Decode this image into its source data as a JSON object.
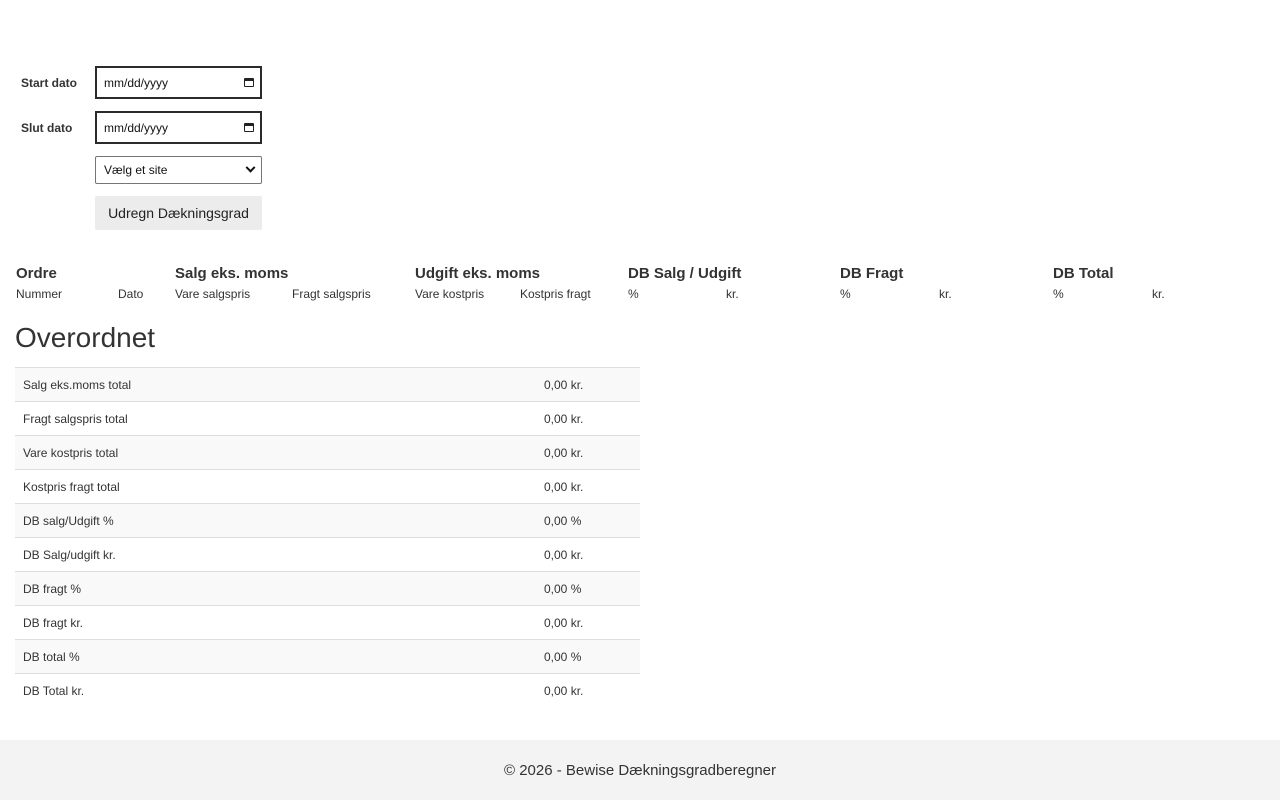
{
  "form": {
    "start_label": "Start dato",
    "start_value": "mm/dd/yyyy",
    "end_label": "Slut dato",
    "end_value": "mm/dd/yyyy",
    "site_select": "Vælg et site",
    "calc_button": "Udregn Dækningsgrad"
  },
  "orders_table": {
    "groups": [
      "Ordre",
      "Salg eks. moms",
      "Udgift eks. moms",
      "DB Salg / Udgift",
      "DB Fragt",
      "DB Total"
    ],
    "columns": [
      "Nummer",
      "Dato",
      "Vare salgspris",
      "Fragt salgspris",
      "Vare kostpris",
      "Kostpris fragt",
      "%",
      "kr.",
      "%",
      "kr.",
      "%",
      "kr."
    ]
  },
  "summary": {
    "title": "Overordnet",
    "rows": [
      {
        "label": "Salg eks.moms total",
        "value": "0,00 kr."
      },
      {
        "label": "Fragt salgspris total",
        "value": "0,00 kr."
      },
      {
        "label": "Vare kostpris total",
        "value": "0,00 kr."
      },
      {
        "label": "Kostpris fragt total",
        "value": "0,00 kr."
      },
      {
        "label": "DB salg/Udgift %",
        "value": "0,00 %"
      },
      {
        "label": "DB Salg/udgift kr.",
        "value": "0,00 kr."
      },
      {
        "label": "DB fragt %",
        "value": "0,00 %"
      },
      {
        "label": "DB fragt kr.",
        "value": "0,00 kr."
      },
      {
        "label": "DB total %",
        "value": "0,00 %"
      },
      {
        "label": "DB Total kr.",
        "value": "0,00 kr."
      }
    ]
  },
  "footer": {
    "text": "© 2026 - Bewise Dækningsgradberegner"
  },
  "icons": {
    "date_picker": "calendar-icon",
    "select_arrow": "chevron-down-icon"
  }
}
